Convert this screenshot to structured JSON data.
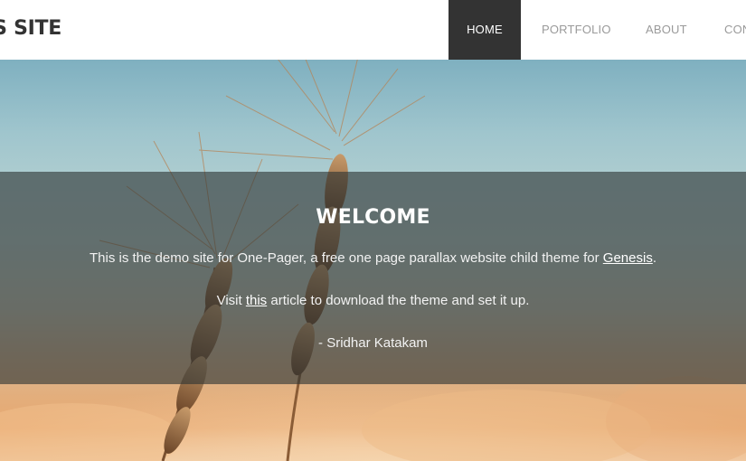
{
  "header": {
    "site_title": "ESIS SITE",
    "nav": {
      "home": "HOME",
      "portfolio": "PORTFOLIO",
      "about": "ABOUT",
      "contact": "CON"
    }
  },
  "hero": {
    "heading": "WELCOME",
    "intro_text": "This is the demo site for One-Pager, a free one page parallax website child theme for ",
    "genesis_link": "Genesis",
    "intro_end": ".",
    "visit_text": "Visit ",
    "this_link": "this",
    "visit_end": " article to download the theme and set it up.",
    "author": "- Sridhar Katakam"
  },
  "colors": {
    "header_bg": "#ffffff",
    "nav_active_bg": "#333333",
    "nav_text": "#9a9a9a",
    "overlay": "#2d3434",
    "sky": "#9fc5cd",
    "field": "#e8a870"
  },
  "icons": {
    "background": "wheat-photo"
  }
}
